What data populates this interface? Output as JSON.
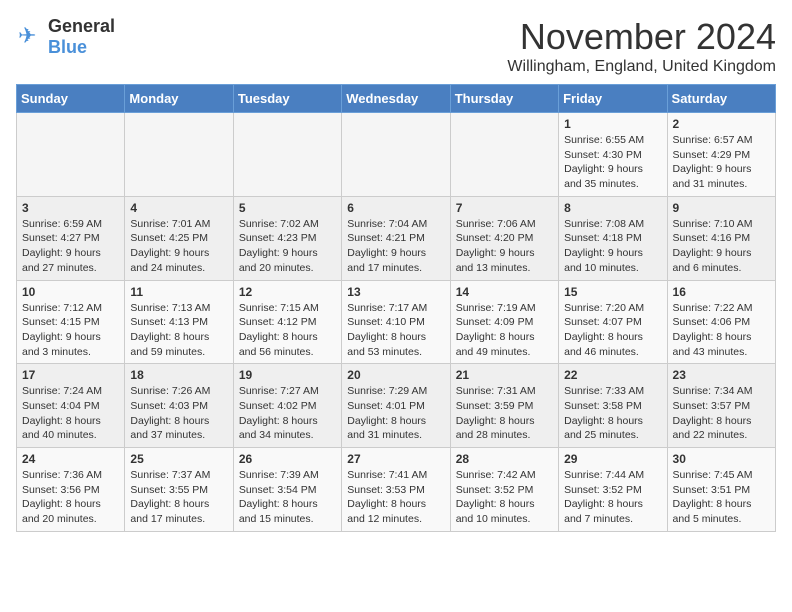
{
  "logo": {
    "general": "General",
    "blue": "Blue"
  },
  "title": "November 2024",
  "location": "Willingham, England, United Kingdom",
  "weekdays": [
    "Sunday",
    "Monday",
    "Tuesday",
    "Wednesday",
    "Thursday",
    "Friday",
    "Saturday"
  ],
  "weeks": [
    [
      {
        "day": "",
        "info": ""
      },
      {
        "day": "",
        "info": ""
      },
      {
        "day": "",
        "info": ""
      },
      {
        "day": "",
        "info": ""
      },
      {
        "day": "",
        "info": ""
      },
      {
        "day": "1",
        "info": "Sunrise: 6:55 AM\nSunset: 4:30 PM\nDaylight: 9 hours\nand 35 minutes."
      },
      {
        "day": "2",
        "info": "Sunrise: 6:57 AM\nSunset: 4:29 PM\nDaylight: 9 hours\nand 31 minutes."
      }
    ],
    [
      {
        "day": "3",
        "info": "Sunrise: 6:59 AM\nSunset: 4:27 PM\nDaylight: 9 hours\nand 27 minutes."
      },
      {
        "day": "4",
        "info": "Sunrise: 7:01 AM\nSunset: 4:25 PM\nDaylight: 9 hours\nand 24 minutes."
      },
      {
        "day": "5",
        "info": "Sunrise: 7:02 AM\nSunset: 4:23 PM\nDaylight: 9 hours\nand 20 minutes."
      },
      {
        "day": "6",
        "info": "Sunrise: 7:04 AM\nSunset: 4:21 PM\nDaylight: 9 hours\nand 17 minutes."
      },
      {
        "day": "7",
        "info": "Sunrise: 7:06 AM\nSunset: 4:20 PM\nDaylight: 9 hours\nand 13 minutes."
      },
      {
        "day": "8",
        "info": "Sunrise: 7:08 AM\nSunset: 4:18 PM\nDaylight: 9 hours\nand 10 minutes."
      },
      {
        "day": "9",
        "info": "Sunrise: 7:10 AM\nSunset: 4:16 PM\nDaylight: 9 hours\nand 6 minutes."
      }
    ],
    [
      {
        "day": "10",
        "info": "Sunrise: 7:12 AM\nSunset: 4:15 PM\nDaylight: 9 hours\nand 3 minutes."
      },
      {
        "day": "11",
        "info": "Sunrise: 7:13 AM\nSunset: 4:13 PM\nDaylight: 8 hours\nand 59 minutes."
      },
      {
        "day": "12",
        "info": "Sunrise: 7:15 AM\nSunset: 4:12 PM\nDaylight: 8 hours\nand 56 minutes."
      },
      {
        "day": "13",
        "info": "Sunrise: 7:17 AM\nSunset: 4:10 PM\nDaylight: 8 hours\nand 53 minutes."
      },
      {
        "day": "14",
        "info": "Sunrise: 7:19 AM\nSunset: 4:09 PM\nDaylight: 8 hours\nand 49 minutes."
      },
      {
        "day": "15",
        "info": "Sunrise: 7:20 AM\nSunset: 4:07 PM\nDaylight: 8 hours\nand 46 minutes."
      },
      {
        "day": "16",
        "info": "Sunrise: 7:22 AM\nSunset: 4:06 PM\nDaylight: 8 hours\nand 43 minutes."
      }
    ],
    [
      {
        "day": "17",
        "info": "Sunrise: 7:24 AM\nSunset: 4:04 PM\nDaylight: 8 hours\nand 40 minutes."
      },
      {
        "day": "18",
        "info": "Sunrise: 7:26 AM\nSunset: 4:03 PM\nDaylight: 8 hours\nand 37 minutes."
      },
      {
        "day": "19",
        "info": "Sunrise: 7:27 AM\nSunset: 4:02 PM\nDaylight: 8 hours\nand 34 minutes."
      },
      {
        "day": "20",
        "info": "Sunrise: 7:29 AM\nSunset: 4:01 PM\nDaylight: 8 hours\nand 31 minutes."
      },
      {
        "day": "21",
        "info": "Sunrise: 7:31 AM\nSunset: 3:59 PM\nDaylight: 8 hours\nand 28 minutes."
      },
      {
        "day": "22",
        "info": "Sunrise: 7:33 AM\nSunset: 3:58 PM\nDaylight: 8 hours\nand 25 minutes."
      },
      {
        "day": "23",
        "info": "Sunrise: 7:34 AM\nSunset: 3:57 PM\nDaylight: 8 hours\nand 22 minutes."
      }
    ],
    [
      {
        "day": "24",
        "info": "Sunrise: 7:36 AM\nSunset: 3:56 PM\nDaylight: 8 hours\nand 20 minutes."
      },
      {
        "day": "25",
        "info": "Sunrise: 7:37 AM\nSunset: 3:55 PM\nDaylight: 8 hours\nand 17 minutes."
      },
      {
        "day": "26",
        "info": "Sunrise: 7:39 AM\nSunset: 3:54 PM\nDaylight: 8 hours\nand 15 minutes."
      },
      {
        "day": "27",
        "info": "Sunrise: 7:41 AM\nSunset: 3:53 PM\nDaylight: 8 hours\nand 12 minutes."
      },
      {
        "day": "28",
        "info": "Sunrise: 7:42 AM\nSunset: 3:52 PM\nDaylight: 8 hours\nand 10 minutes."
      },
      {
        "day": "29",
        "info": "Sunrise: 7:44 AM\nSunset: 3:52 PM\nDaylight: 8 hours\nand 7 minutes."
      },
      {
        "day": "30",
        "info": "Sunrise: 7:45 AM\nSunset: 3:51 PM\nDaylight: 8 hours\nand 5 minutes."
      }
    ]
  ]
}
